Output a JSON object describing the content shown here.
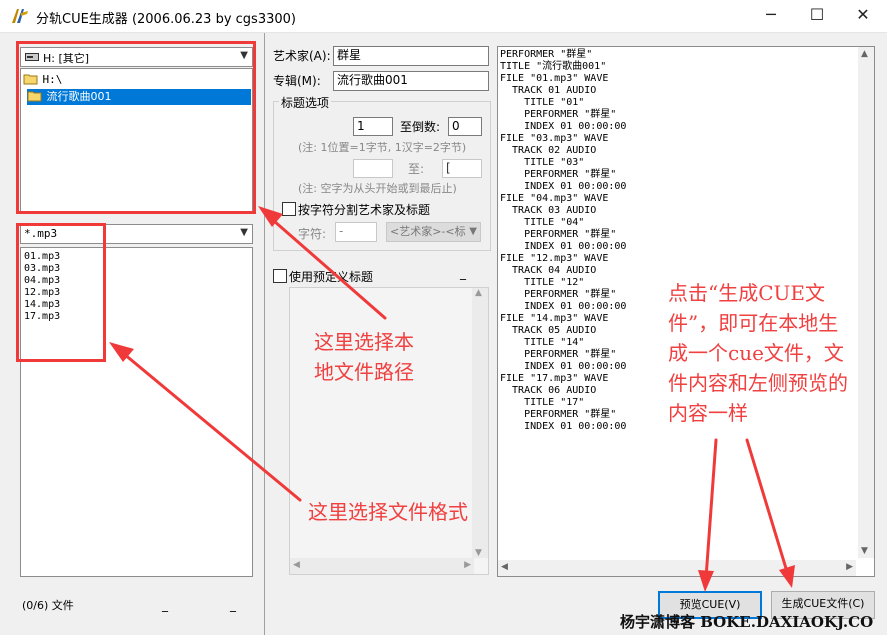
{
  "window": {
    "title": "分轨CUE生成器 (2006.06.23 by cgs3300)",
    "min_glyph": "─",
    "max_glyph": "☐",
    "close_glyph": "✕"
  },
  "left": {
    "drive": "H: [其它]",
    "tree": [
      "H:\\",
      "流行歌曲001"
    ],
    "filter": "*.mp3",
    "files": [
      "01.mp3",
      "03.mp3",
      "04.mp3",
      "12.mp3",
      "14.mp3",
      "17.mp3"
    ],
    "status": "(0/6) 文件",
    "status_sep1": "_",
    "status_sep2": "_"
  },
  "form": {
    "artist_label": "艺术家(A):",
    "artist_value": "群星",
    "album_label": "专辑(M):",
    "album_value": "流行歌曲001",
    "group_title": "标题选项",
    "from_value": "1",
    "reverse_label": "至倒数:",
    "reverse_value": "0",
    "note1": "(注: 1位置=1字节, 1汉字=2字节)",
    "to_label": "至:",
    "to_value": "[",
    "note2": "(注: 空字为从头开始或到最后止)",
    "split_label": "按字符分割艺术家及标题",
    "char_label": "字符:",
    "char_value": "-",
    "pattern_value": "<艺术家>-<标",
    "predefined_label": "使用预定义标题",
    "predefined_sep": "_"
  },
  "cue_text": "PERFORMER \"群星\"\nTITLE \"流行歌曲001\"\nFILE \"01.mp3\" WAVE\n  TRACK 01 AUDIO\n    TITLE \"01\"\n    PERFORMER \"群星\"\n    INDEX 01 00:00:00\nFILE \"03.mp3\" WAVE\n  TRACK 02 AUDIO\n    TITLE \"03\"\n    PERFORMER \"群星\"\n    INDEX 01 00:00:00\nFILE \"04.mp3\" WAVE\n  TRACK 03 AUDIO\n    TITLE \"04\"\n    PERFORMER \"群星\"\n    INDEX 01 00:00:00\nFILE \"12.mp3\" WAVE\n  TRACK 04 AUDIO\n    TITLE \"12\"\n    PERFORMER \"群星\"\n    INDEX 01 00:00:00\nFILE \"14.mp3\" WAVE\n  TRACK 05 AUDIO\n    TITLE \"14\"\n    PERFORMER \"群星\"\n    INDEX 01 00:00:00\nFILE \"17.mp3\" WAVE\n  TRACK 06 AUDIO\n    TITLE \"17\"\n    PERFORMER \"群星\"\n    INDEX 01 00:00:00",
  "buttons": {
    "preview": "预览CUE(V)",
    "generate": "生成CUE文件(C)"
  },
  "annotations": {
    "path_line1": "这里选择本",
    "path_line2": "地文件路径",
    "format": "这里选择文件格式",
    "cue_line1": "点击“生成CUE文",
    "cue_line2": "件”，即可在本地生",
    "cue_line3": "成一个cue文件，文",
    "cue_line4": "件内容和左侧预览的",
    "cue_line5": "内容一样"
  },
  "watermark": "杨宇潇博客 BOKE.DAXIAOKJ.CO",
  "colors": {
    "accent": "#0078d7",
    "annotation": "#f03a3a"
  }
}
